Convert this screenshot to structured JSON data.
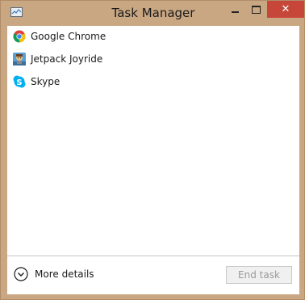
{
  "window": {
    "title": "Task Manager",
    "close_glyph": "✕"
  },
  "processes": [
    {
      "label": "Google Chrome",
      "icon": "chrome-icon"
    },
    {
      "label": "Jetpack Joyride",
      "icon": "jetpack-joyride-icon"
    },
    {
      "label": "Skype",
      "icon": "skype-icon"
    }
  ],
  "footer": {
    "more_details_label": "More details",
    "end_task_label": "End task"
  },
  "colors": {
    "frame": "#c9a783",
    "close_button": "#c7463a",
    "chrome_red": "#db4437",
    "chrome_green": "#0f9d58",
    "chrome_yellow": "#f4c20d",
    "chrome_blue": "#4285f4",
    "skype_blue": "#00aff0"
  }
}
